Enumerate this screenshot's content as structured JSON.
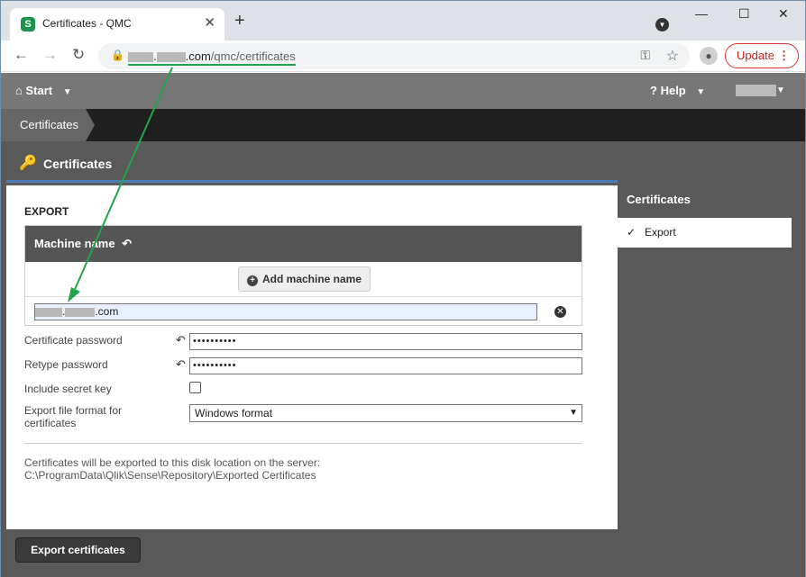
{
  "browser": {
    "tab_title": "Certificates - QMC",
    "tab_favicon": "S",
    "url_suffix": ".com",
    "url_path": "/qmc/certificates",
    "update_label": "Update",
    "accent": "#23a34a"
  },
  "qmc": {
    "start_label": "Start",
    "help_label": "Help",
    "breadcrumb": "Certificates",
    "panel_title": "Certificates",
    "export_heading": "EXPORT",
    "machine_header": "Machine name",
    "add_machine_label": "Add machine name",
    "machine_value_suffix": ".com",
    "cert_password_label": "Certificate password",
    "cert_password_value": "••••••••••",
    "retype_label": "Retype password",
    "retype_value": "••••••••••",
    "include_key_label": "Include secret key",
    "format_label_1": "Export file format for",
    "format_label_2": "certificates",
    "format_value": "Windows format",
    "note_1": "Certificates will be exported to this disk location on the server:",
    "note_2": "C:\\ProgramData\\Qlik\\Sense\\Repository\\Exported Certificates",
    "export_button": "Export certificates"
  },
  "sidebar": {
    "heading": "Certificates",
    "items": [
      {
        "label": "Export",
        "selected": true
      }
    ]
  }
}
